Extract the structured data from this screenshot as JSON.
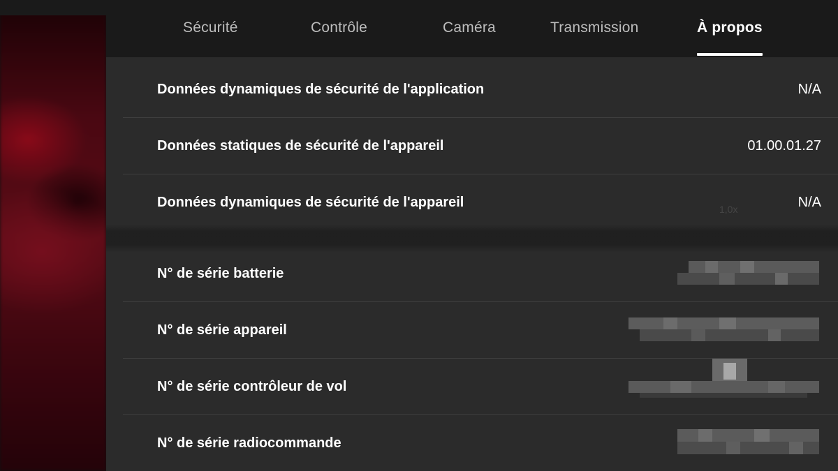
{
  "tabs": [
    {
      "label": "Sécurité",
      "active": false
    },
    {
      "label": "Contrôle",
      "active": false
    },
    {
      "label": "Caméra",
      "active": false
    },
    {
      "label": "Transmission",
      "active": false
    },
    {
      "label": "À propos",
      "active": true
    }
  ],
  "security_rows": [
    {
      "label": "Données dynamiques de sécurité de l'application",
      "value": "N/A"
    },
    {
      "label": "Données statiques de sécurité de l'appareil",
      "value": "01.00.01.27"
    },
    {
      "label": "Données dynamiques de sécurité de l'appareil",
      "value": "N/A"
    }
  ],
  "serial_rows": [
    {
      "label": "N° de série batterie"
    },
    {
      "label": "N° de série appareil"
    },
    {
      "label": "N° de série contrôleur de vol"
    },
    {
      "label": "N° de série radiocommande"
    }
  ],
  "background_ghost_text": "1,0x",
  "colors": {
    "panel_bg": "#2b2b2b",
    "tabbar_bg": "#1a1a1a",
    "active_tab": "#ffffff",
    "inactive_tab": "#bdbdbd",
    "divider": "#3f3f3f"
  }
}
